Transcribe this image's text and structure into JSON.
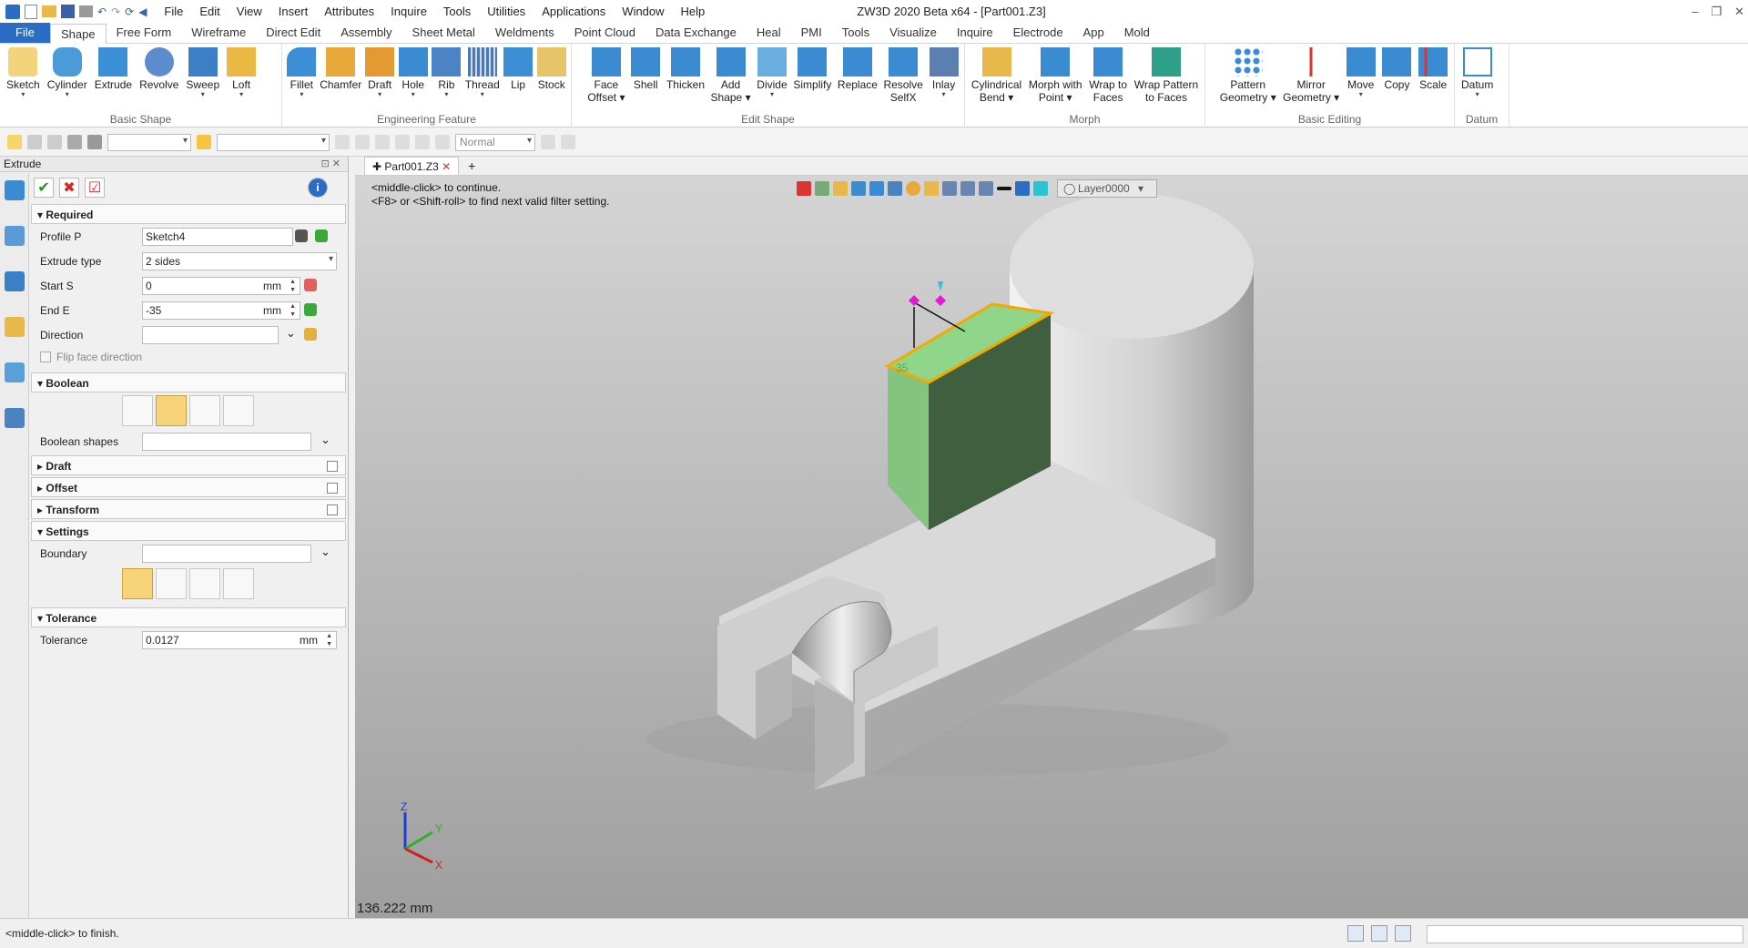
{
  "app": {
    "title": "ZW3D 2020 Beta x64 - [Part001.Z3]",
    "menu": [
      "File",
      "Edit",
      "View",
      "Insert",
      "Attributes",
      "Inquire",
      "Tools",
      "Utilities",
      "Applications",
      "Window",
      "Help"
    ]
  },
  "tabs": [
    "File",
    "Shape",
    "Free Form",
    "Wireframe",
    "Direct Edit",
    "Assembly",
    "Sheet Metal",
    "Weldments",
    "Point Cloud",
    "Data Exchange",
    "Heal",
    "PMI",
    "Tools",
    "Visualize",
    "Inquire",
    "Electrode",
    "App",
    "Mold"
  ],
  "ribbon": {
    "groups": [
      {
        "label": "Basic Shape",
        "buttons": [
          "Sketch",
          "Cylinder",
          "Extrude",
          "Revolve",
          "Sweep",
          "Loft"
        ]
      },
      {
        "label": "Engineering Feature",
        "buttons": [
          "Fillet",
          "Chamfer",
          "Draft",
          "Hole",
          "Rib",
          "Thread",
          "Lip",
          "Stock"
        ]
      },
      {
        "label": "Edit Shape",
        "buttons": [
          "Face Offset",
          "Shell",
          "Thicken",
          "Add Shape",
          "Divide",
          "Simplify",
          "Replace",
          "Resolve SelfX",
          "Inlay"
        ]
      },
      {
        "label": "Morph",
        "buttons": [
          "Cylindrical Bend",
          "Morph with Point",
          "Wrap to Faces",
          "Wrap Pattern to Faces"
        ]
      },
      {
        "label": "Basic Editing",
        "buttons": [
          "Pattern Geometry",
          "Mirror Geometry",
          "Move",
          "Copy",
          "Scale"
        ]
      },
      {
        "label": "Datum",
        "buttons": [
          "Datum"
        ]
      }
    ]
  },
  "toolbar2": {
    "style_value": "Normal"
  },
  "panel": {
    "title": "Extrude",
    "sections": {
      "required": "Required",
      "boolean": "Boolean",
      "draft": "Draft",
      "offset": "Offset",
      "transform": "Transform",
      "settings": "Settings",
      "tolerance": "Tolerance"
    },
    "fields": {
      "profile_label": "Profile P",
      "profile_value": "Sketch4",
      "extrude_type_label": "Extrude type",
      "extrude_type_value": "2 sides",
      "start_label": "Start S",
      "start_value": "0",
      "end_label": "End E",
      "end_value": "-35",
      "unit": "mm",
      "direction_label": "Direction",
      "flip_label": "Flip face direction",
      "boolean_shapes_label": "Boolean shapes",
      "boundary_label": "Boundary",
      "tolerance_label": "Tolerance",
      "tolerance_value": "0.0127"
    }
  },
  "document": {
    "tab": "Part001.Z3",
    "hint_line1": "<middle-click> to continue.",
    "hint_line2": "<F8> or <Shift-roll> to find next valid filter setting.",
    "layer": "Layer0000",
    "measure": "136.222 mm",
    "dimension_label": "35"
  },
  "status": {
    "text": "<middle-click> to finish."
  },
  "colors": {
    "accent": "#2b6cc4",
    "preview_green": "#8fd68a",
    "highlight_orange": "#f2a900"
  }
}
